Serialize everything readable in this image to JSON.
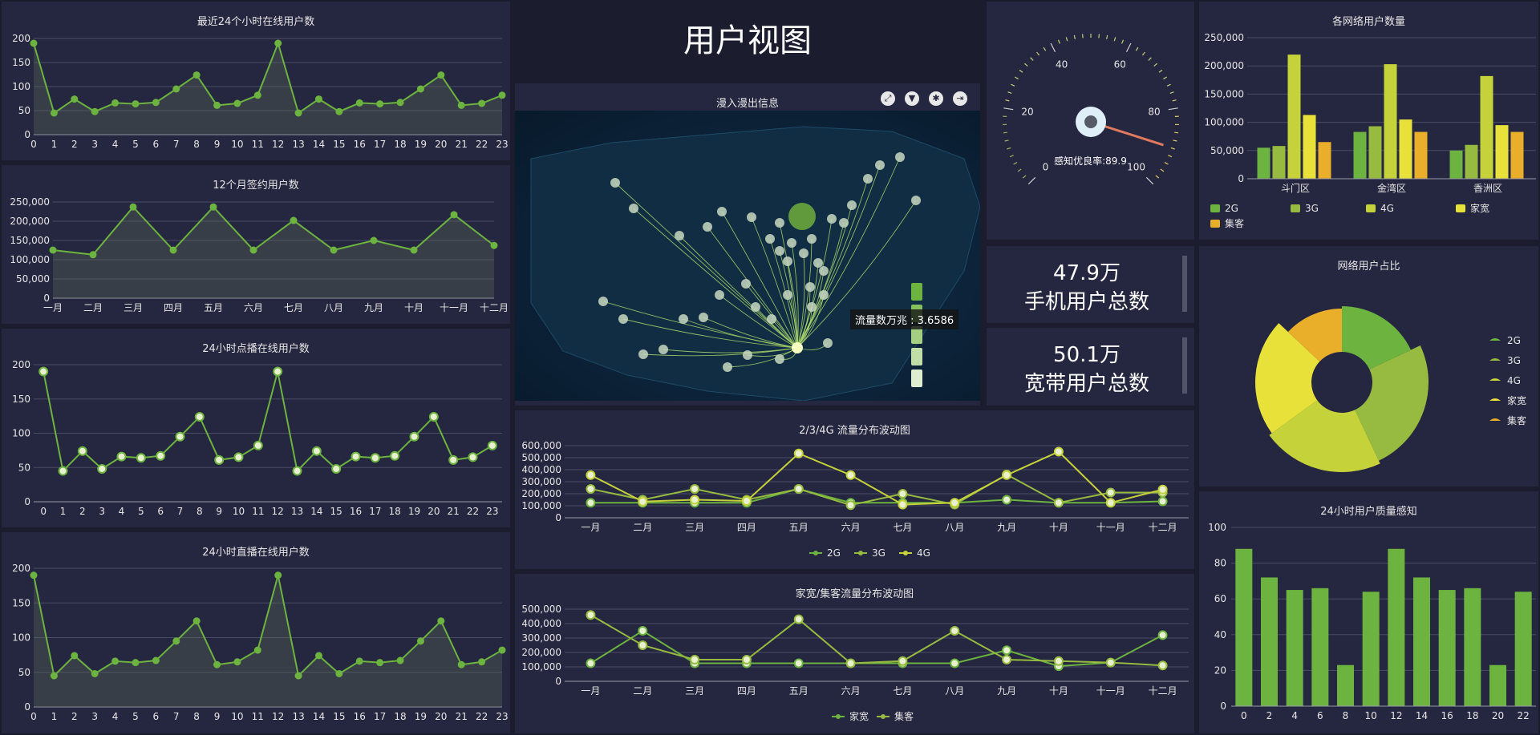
{
  "page": {
    "title": "用户视图"
  },
  "colors": {
    "green": "#6cb33f",
    "light_green": "#97bb40",
    "yellow_green": "#c6d23a",
    "yellow": "#e8e13a",
    "orange": "#eaaf2a",
    "grid": "#4a4c66",
    "area": "rgba(90,110,90,0.35)"
  },
  "stats": {
    "mobile": {
      "value": "47.9万",
      "label": "手机用户总数"
    },
    "broadband": {
      "value": "50.1万",
      "label": "宽带用户总数"
    }
  },
  "map": {
    "title": "漫入漫出信息",
    "tooltip": "流量数万兆 : 3.6586",
    "tools": [
      "fullscreen-icon",
      "filter-icon",
      "settings-icon",
      "export-icon"
    ]
  },
  "chart_data": [
    {
      "id": "online24",
      "type": "area",
      "title": "最近24个小时在线用户数",
      "x": [
        "0",
        "1",
        "2",
        "3",
        "4",
        "5",
        "6",
        "7",
        "8",
        "9",
        "10",
        "11",
        "12",
        "13",
        "14",
        "15",
        "16",
        "17",
        "18",
        "19",
        "20",
        "21",
        "22",
        "23"
      ],
      "values": [
        190,
        45,
        74,
        48,
        66,
        64,
        67,
        95,
        124,
        61,
        65,
        82,
        190,
        45,
        74,
        48,
        66,
        64,
        67,
        95,
        124,
        61,
        65,
        82
      ],
      "ylim": [
        0,
        200
      ],
      "yticks": [
        0,
        50,
        100,
        150,
        200
      ]
    },
    {
      "id": "contract12",
      "type": "area",
      "title": "12个月签约用户数",
      "x": [
        "一月",
        "二月",
        "三月",
        "四月",
        "五月",
        "六月",
        "七月",
        "八月",
        "九月",
        "十月",
        "十一月",
        "十二月"
      ],
      "values": [
        125000,
        113000,
        237000,
        125000,
        237000,
        125000,
        202000,
        125000,
        150000,
        125000,
        217000,
        137000
      ],
      "ylim": [
        0,
        250000
      ],
      "yticks": [
        "0",
        "50,000",
        "100,000",
        "150,000",
        "200,000",
        "250,000"
      ]
    },
    {
      "id": "vod24",
      "type": "line",
      "title": "24小时点播在线用户数",
      "x": [
        "0",
        "1",
        "2",
        "3",
        "4",
        "5",
        "6",
        "7",
        "8",
        "9",
        "10",
        "11",
        "12",
        "13",
        "14",
        "15",
        "16",
        "17",
        "18",
        "19",
        "20",
        "21",
        "22",
        "23"
      ],
      "values": [
        190,
        45,
        74,
        48,
        66,
        64,
        67,
        95,
        124,
        61,
        65,
        82,
        190,
        45,
        74,
        48,
        66,
        64,
        67,
        95,
        124,
        61,
        65,
        82
      ],
      "ylim": [
        0,
        200
      ],
      "yticks": [
        0,
        50,
        100,
        150,
        200
      ]
    },
    {
      "id": "live24",
      "type": "area",
      "title": "24小时直播在线用户数",
      "x": [
        "0",
        "1",
        "2",
        "3",
        "4",
        "5",
        "6",
        "7",
        "8",
        "9",
        "10",
        "11",
        "12",
        "13",
        "14",
        "15",
        "16",
        "17",
        "18",
        "19",
        "20",
        "21",
        "22",
        "23"
      ],
      "values": [
        190,
        45,
        74,
        48,
        66,
        64,
        67,
        95,
        124,
        61,
        65,
        82,
        190,
        45,
        74,
        48,
        66,
        64,
        67,
        95,
        124,
        61,
        65,
        82
      ],
      "ylim": [
        0,
        200
      ],
      "yticks": [
        0,
        50,
        100,
        150,
        200
      ]
    },
    {
      "id": "flow234g",
      "type": "line",
      "title": "2/3/4G 流量分布波动图",
      "x": [
        "一月",
        "二月",
        "三月",
        "四月",
        "五月",
        "六月",
        "七月",
        "八月",
        "九月",
        "十月",
        "十一月",
        "十二月"
      ],
      "series": [
        {
          "name": "2G",
          "values": [
            125000,
            125000,
            125000,
            125000,
            240000,
            125000,
            125000,
            125000,
            150000,
            125000,
            125000,
            137000
          ]
        },
        {
          "name": "3G",
          "values": [
            240000,
            150000,
            240000,
            150000,
            240000,
            105000,
            200000,
            110000,
            360000,
            125000,
            210000,
            210000
          ]
        },
        {
          "name": "4G",
          "values": [
            355000,
            135000,
            150000,
            140000,
            535000,
            355000,
            110000,
            125000,
            355000,
            550000,
            125000,
            235000
          ]
        }
      ],
      "ylim": [
        0,
        600000
      ],
      "yticks": [
        "0",
        "100,000",
        "200,000",
        "300,000",
        "400,000",
        "500,000",
        "600,000"
      ]
    },
    {
      "id": "flowbb",
      "type": "line",
      "title": "家宽/集客流量分布波动图",
      "x": [
        "一月",
        "二月",
        "三月",
        "四月",
        "五月",
        "六月",
        "七月",
        "八月",
        "九月",
        "十月",
        "十一月",
        "十二月"
      ],
      "series": [
        {
          "name": "家宽",
          "values": [
            125000,
            350000,
            125000,
            125000,
            125000,
            125000,
            125000,
            125000,
            215000,
            105000,
            130000,
            320000
          ]
        },
        {
          "name": "集客",
          "values": [
            460000,
            250000,
            150000,
            150000,
            430000,
            125000,
            140000,
            350000,
            150000,
            140000,
            130000,
            110000
          ]
        }
      ],
      "ylim": [
        0,
        500000
      ],
      "yticks": [
        "0",
        "100,000",
        "200,000",
        "300,000",
        "400,000",
        "500,000"
      ]
    },
    {
      "id": "netusers",
      "type": "bar",
      "title": "各网络用户数量",
      "categories": [
        "斗门区",
        "金湾区",
        "香洲区"
      ],
      "series": [
        {
          "name": "2G",
          "values": [
            55000,
            83000,
            50000
          ]
        },
        {
          "name": "3G",
          "values": [
            58000,
            93000,
            60000
          ]
        },
        {
          "name": "4G",
          "values": [
            220000,
            203000,
            182000
          ]
        },
        {
          "name": "家宽",
          "values": [
            113000,
            105000,
            95000
          ]
        },
        {
          "name": "集客",
          "values": [
            65000,
            83000,
            83000
          ]
        }
      ],
      "ylim": [
        0,
        250000
      ],
      "yticks": [
        "0",
        "50,000",
        "100,000",
        "150,000",
        "200,000",
        "250,000"
      ]
    },
    {
      "id": "netshare",
      "type": "pie",
      "title": "网络用户占比",
      "series": [
        {
          "name": "2G",
          "value": 18
        },
        {
          "name": "3G",
          "value": 25
        },
        {
          "name": "4G",
          "value": 22
        },
        {
          "name": "家宽",
          "value": 22
        },
        {
          "name": "集客",
          "value": 13
        }
      ]
    },
    {
      "id": "quality24",
      "type": "bar",
      "title": "24小时用户质量感知",
      "x": [
        "0",
        "2",
        "4",
        "6",
        "8",
        "10",
        "12",
        "14",
        "16",
        "18",
        "20",
        "22"
      ],
      "values": [
        88,
        72,
        65,
        66,
        23,
        64,
        88,
        72,
        65,
        66,
        23,
        64
      ],
      "ylim": [
        0,
        100
      ],
      "yticks": [
        0,
        20,
        40,
        60,
        80,
        100
      ]
    },
    {
      "id": "gauge",
      "type": "gauge",
      "title": "感知优良率",
      "value": 89.9,
      "min": 0,
      "max": 100,
      "label": "感知优良率:89.9",
      "ticks": [
        "0",
        "20",
        "40",
        "60",
        "80",
        "100"
      ]
    }
  ]
}
